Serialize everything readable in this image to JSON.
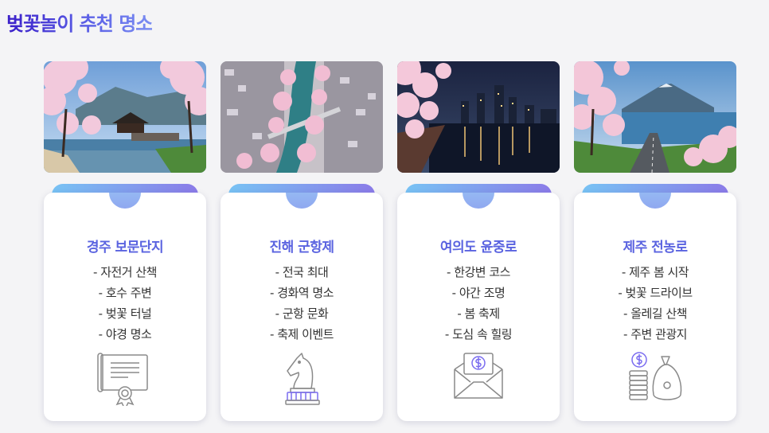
{
  "page": {
    "title": "벚꽃놀이 추천 명소"
  },
  "colors": {
    "accent": "#5a63e0",
    "tab_from": "#78c3f4",
    "tab_to": "#8b7be8",
    "icon": "#8a8a8a"
  },
  "cards": [
    {
      "title": "경주 보문단지",
      "items": [
        "- 자전거 산책",
        "- 호수 주변",
        "- 벚꽃 터널",
        "- 야경 명소"
      ],
      "icon": "certificate-icon",
      "photo": "gyeongju-lake-pavilion-photo"
    },
    {
      "title": "진해 군항제",
      "items": [
        "- 전국 최대",
        "- 경화역 명소",
        "- 군항 문화",
        "- 축제 이벤트"
      ],
      "icon": "chess-knight-icon",
      "photo": "jinhae-river-aerial-photo"
    },
    {
      "title": "여의도 윤중로",
      "items": [
        "- 한강변 코스",
        "- 야간 조명",
        "- 봄 축제",
        "- 도심 속 힐링"
      ],
      "icon": "money-envelope-icon",
      "photo": "yeouido-night-skyline-photo"
    },
    {
      "title": "제주 전농로",
      "items": [
        "- 제주 봄 시작",
        "- 벚꽃 드라이브",
        "- 올레길 산책",
        "- 주변 관광지"
      ],
      "icon": "coins-moneybag-icon",
      "photo": "jeju-coastal-road-photo"
    }
  ]
}
